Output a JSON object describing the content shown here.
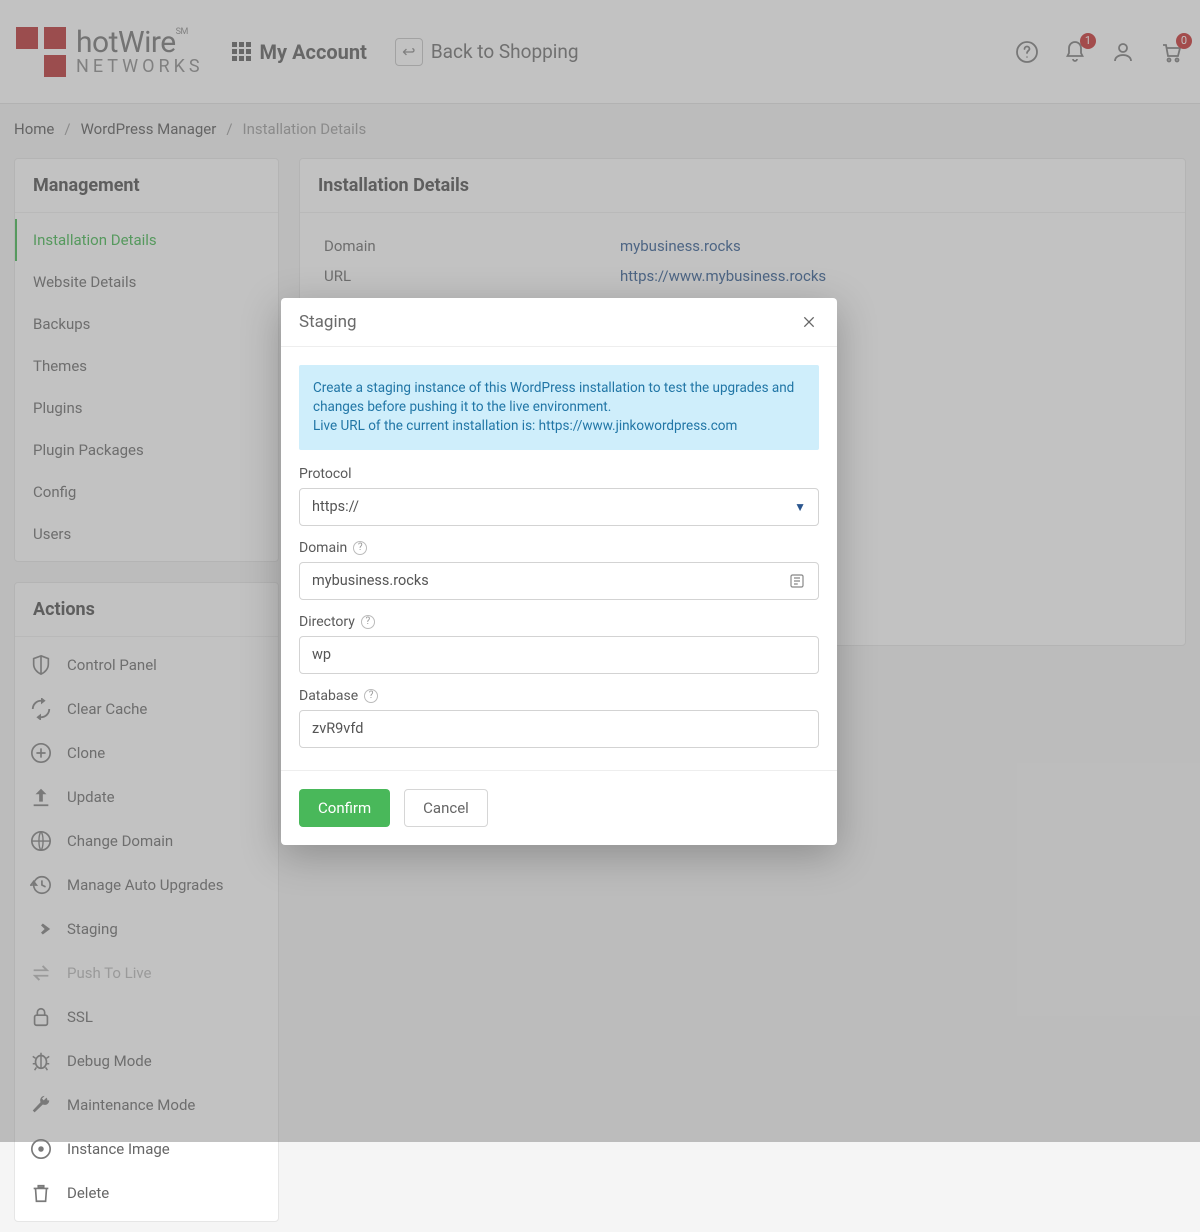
{
  "brand": {
    "line1_a": "hot",
    "line1_b": "Wire",
    "sm": "SM",
    "line2": "NETWORKS"
  },
  "header": {
    "my_account": "My Account",
    "back_to_shopping": "Back to Shopping",
    "notif_count": "1",
    "cart_count": "0"
  },
  "breadcrumb": {
    "home": "Home",
    "wp_manager": "WordPress Manager",
    "current": "Installation Details"
  },
  "management": {
    "heading": "Management",
    "items": [
      "Installation Details",
      "Website Details",
      "Backups",
      "Themes",
      "Plugins",
      "Plugin Packages",
      "Config",
      "Users"
    ]
  },
  "actions": {
    "heading": "Actions",
    "items": [
      "Control Panel",
      "Clear Cache",
      "Clone",
      "Update",
      "Change Domain",
      "Manage Auto Upgrades",
      "Staging",
      "Push To Live",
      "SSL",
      "Debug Mode",
      "Maintenance Mode",
      "Instance Image",
      "Delete"
    ]
  },
  "details": {
    "heading": "Installation Details",
    "domain_label": "Domain",
    "domain_value": "mybusiness.rocks",
    "url_label": "URL",
    "url_value": "https://www.mybusiness.rocks"
  },
  "modal": {
    "title": "Staging",
    "info_line1": "Create a staging instance of this WordPress installation to test the upgrades and changes before pushing it to the live environment.",
    "info_line2": "Live URL of the current installation is: https://www.jinkowordpress.com",
    "protocol": {
      "label": "Protocol",
      "value": "https://"
    },
    "domain": {
      "label": "Domain",
      "value": "mybusiness.rocks"
    },
    "directory": {
      "label": "Directory",
      "value": "wp"
    },
    "database": {
      "label": "Database",
      "value": "zvR9vfd"
    },
    "confirm": "Confirm",
    "cancel": "Cancel"
  }
}
